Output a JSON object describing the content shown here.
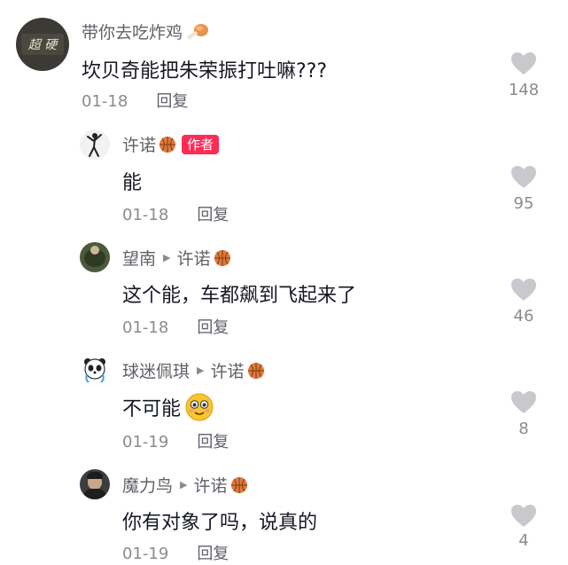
{
  "comments": [
    {
      "user": "带你去吃炸鸡",
      "user_suffix_icon": "chicken-leg-icon",
      "avatar_text": "超 硬",
      "text": "坎贝奇能把朱荣振打吐嘛???",
      "date": "01-18",
      "reply_label": "回复",
      "likes": "148"
    },
    {
      "user": "许诺",
      "author_badge": "作者",
      "text": "能",
      "date": "01-18",
      "reply_label": "回复",
      "likes": "95"
    },
    {
      "user": "望南",
      "reply_to": "许诺",
      "text": "这个能，车都飙到飞起来了",
      "date": "01-18",
      "reply_label": "回复",
      "likes": "46"
    },
    {
      "user": "球迷佩琪",
      "reply_to": "许诺",
      "text": "不可能",
      "text_emoji": "smiling-face-emoji",
      "date": "01-19",
      "reply_label": "回复",
      "likes": "8"
    },
    {
      "user": "魔力鸟",
      "reply_to": "许诺",
      "text": "你有对象了吗，说真的",
      "date": "01-19",
      "reply_label": "回复",
      "likes": "4"
    }
  ],
  "colors": {
    "accent": "#fe2c55",
    "heart": "#c8c9cc",
    "meta": "#8a8b91",
    "basketball": "#e07a3a"
  }
}
